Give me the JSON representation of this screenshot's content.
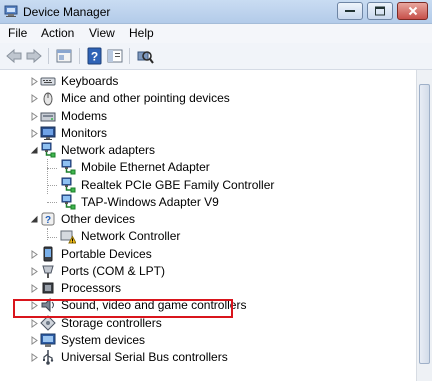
{
  "window": {
    "title": "Device Manager",
    "minimize_glyph": "minimize-icon",
    "maximize_glyph": "maximize-icon",
    "close_glyph": "close-icon"
  },
  "menu": [
    "File",
    "Action",
    "View",
    "Help"
  ],
  "toolbar": [
    "back-arrow-icon",
    "forward-arrow-icon",
    "properties-icon",
    "help-icon",
    "show-hide-icon",
    "scan-hardware-icon"
  ],
  "tree": [
    {
      "label": "Keyboards",
      "icon": "keyboard-icon",
      "expander": "collapsed",
      "level": 0
    },
    {
      "label": "Mice and other pointing devices",
      "icon": "mouse-icon",
      "expander": "collapsed",
      "level": 0
    },
    {
      "label": "Modems",
      "icon": "modem-icon",
      "expander": "collapsed",
      "level": 0
    },
    {
      "label": "Monitors",
      "icon": "monitor-icon",
      "expander": "collapsed",
      "level": 0
    },
    {
      "label": "Network adapters",
      "icon": "network-adapter-icon",
      "expander": "expanded",
      "level": 0
    },
    {
      "label": "Mobile Ethernet Adapter",
      "icon": "network-adapter-icon",
      "expander": "none",
      "level": 1
    },
    {
      "label": "Realtek PCIe GBE Family Controller",
      "icon": "network-adapter-icon",
      "expander": "none",
      "level": 1
    },
    {
      "label": "TAP-Windows Adapter V9",
      "icon": "network-adapter-icon",
      "expander": "none",
      "level": 1
    },
    {
      "label": "Other devices",
      "icon": "other-devices-icon",
      "expander": "expanded",
      "level": 0
    },
    {
      "label": "Network Controller",
      "icon": "warning-device-icon",
      "expander": "none",
      "level": 1,
      "highlighted": true
    },
    {
      "label": "Portable Devices",
      "icon": "portable-device-icon",
      "expander": "collapsed",
      "level": 0
    },
    {
      "label": "Ports (COM & LPT)",
      "icon": "port-icon",
      "expander": "collapsed",
      "level": 0
    },
    {
      "label": "Processors",
      "icon": "processor-icon",
      "expander": "collapsed",
      "level": 0
    },
    {
      "label": "Sound, video and game controllers",
      "icon": "sound-icon",
      "expander": "collapsed",
      "level": 0
    },
    {
      "label": "Storage controllers",
      "icon": "storage-icon",
      "expander": "collapsed",
      "level": 0
    },
    {
      "label": "System devices",
      "icon": "system-devices-icon",
      "expander": "collapsed",
      "level": 0
    },
    {
      "label": "Universal Serial Bus controllers",
      "icon": "usb-icon",
      "expander": "collapsed",
      "level": 0
    }
  ],
  "colors": {
    "highlight_border": "#d9151c",
    "title_bar": "#c9dcf2",
    "close_button": "#c7504a"
  }
}
